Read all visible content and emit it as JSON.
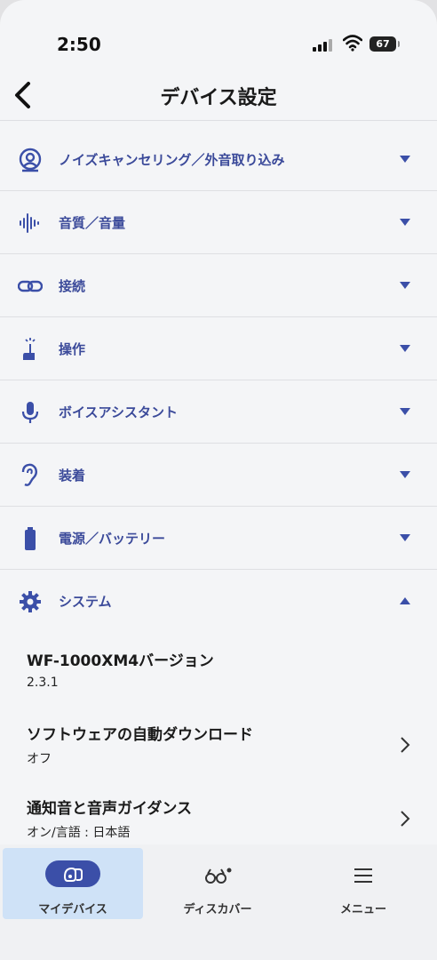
{
  "status_bar": {
    "time": "2:50",
    "battery": "67"
  },
  "nav": {
    "title": "デバイス設定"
  },
  "menu": [
    {
      "label": "ノイズキャンセリング／外音取り込み",
      "icon": "person-ambient-icon",
      "expanded": false
    },
    {
      "label": "音質／音量",
      "icon": "sound-wave-icon",
      "expanded": false
    },
    {
      "label": "接続",
      "icon": "link-icon",
      "expanded": false
    },
    {
      "label": "操作",
      "icon": "touch-icon",
      "expanded": false
    },
    {
      "label": "ボイスアシスタント",
      "icon": "microphone-icon",
      "expanded": false
    },
    {
      "label": "装着",
      "icon": "ear-icon",
      "expanded": false
    },
    {
      "label": "電源／バッテリー",
      "icon": "battery-icon",
      "expanded": false
    },
    {
      "label": "システム",
      "icon": "gear-icon",
      "expanded": true
    }
  ],
  "system_items": [
    {
      "title": "WF-1000XM4バージョン",
      "value": "2.3.1"
    },
    {
      "title": "ソフトウェアの自動ダウンロード",
      "value": "オフ"
    },
    {
      "title": "通知音と音声ガイダンス",
      "value": "オン/言語 : 日本語"
    }
  ],
  "tabs": [
    {
      "label": "マイデバイス",
      "icon": "earbuds-icon",
      "active": true
    },
    {
      "label": "ディスカバー",
      "icon": "binoculars-icon",
      "active": false
    },
    {
      "label": "メニュー",
      "icon": "hamburger-icon",
      "active": false
    }
  ],
  "colors": {
    "accent": "#3b4fa8",
    "label": "#3b4a9a",
    "active_tab_bg": "#cfe2f7"
  }
}
